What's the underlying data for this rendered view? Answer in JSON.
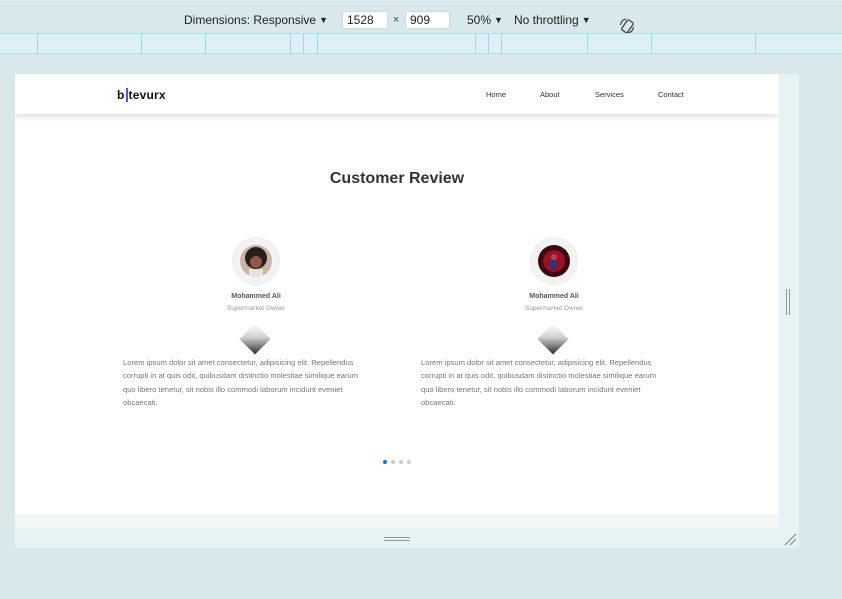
{
  "devtools": {
    "dimensions_label": "Dimensions: Responsive",
    "width_value": "1528",
    "times": "×",
    "height_value": "909",
    "zoom": "50%",
    "throttling": "No throttling",
    "rotate_icon": "rotate-device-icon"
  },
  "site": {
    "logo": {
      "before": "b",
      "after": "tevurx",
      "accent_color": "#7b3fe4"
    },
    "nav": [
      "Home",
      "About",
      "Services",
      "Contact"
    ],
    "section_title": "Customer Review",
    "reviews": [
      {
        "name": "Mohammed Ali",
        "role": "Supermarket Owner",
        "text": "Lorem ipsum dolor sit amet consectetur, adipisicing elit. Repellendus corrupti in at quis odit, quibusdam distinctio molestiae similique earum quo libero tenetur, sit nobis illo commodi laborum incidunt eveniet obcaecati."
      },
      {
        "name": "Mohammed Ali",
        "role": "Supermarket Owner",
        "text": "Lorem ipsum dolor sit amet consectetur, adipisicing elit. Repellendus corrupti in at quis odit, quibusdam distinctio molestiae similique earum quo libero tenetur, sit nobis illo commodi laborum incidunt eveniet obcaecati."
      }
    ],
    "carousel": {
      "total": 4,
      "active_index": 0,
      "active_color": "#1976d2"
    }
  }
}
